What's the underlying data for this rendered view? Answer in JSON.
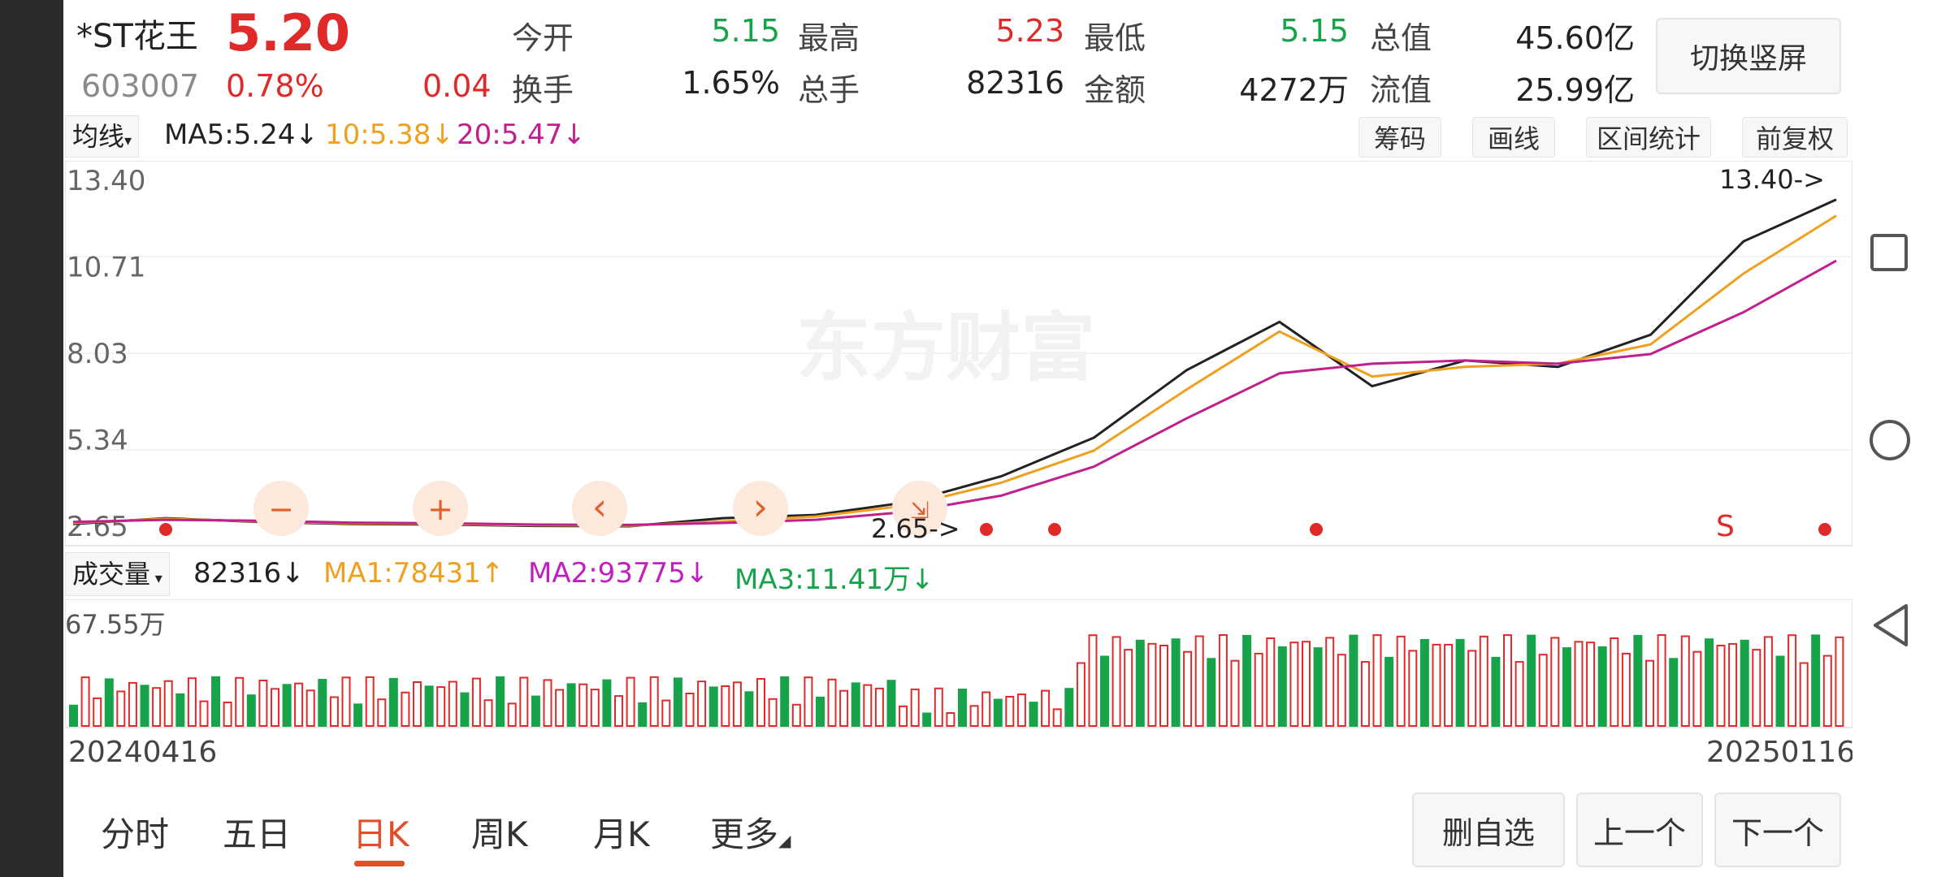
{
  "stock": {
    "name": "*ST花王",
    "price": "5.20",
    "code": "603007",
    "change_pct": "0.78%",
    "change_abs": "0.04"
  },
  "quote": {
    "open_label": "今开",
    "open": "5.15",
    "high_label": "最高",
    "high": "5.23",
    "low_label": "最低",
    "low": "5.15",
    "mcap_label": "总值",
    "mcap": "45.60亿",
    "turnover_label": "换手",
    "turnover": "1.65%",
    "volume_label": "总手",
    "volume": "82316",
    "amount_label": "金额",
    "amount": "4272万",
    "float_label": "流值",
    "float": "25.99亿"
  },
  "switch_button": "切换竖屏",
  "ma_bar": {
    "selector": "均线",
    "ma5": "MA5:5.24↓",
    "ma10": "10:5.38↓",
    "ma20": "20:5.47↓"
  },
  "tools": {
    "chips": "筹码",
    "draw": "画线",
    "range": "区间统计",
    "adjust": "前复权"
  },
  "watermark": "东方财富",
  "zoom_controls": {
    "zoom_out": "−",
    "zoom_in": "+",
    "left": "‹",
    "right": "›"
  },
  "annotations": {
    "high": "13.40->",
    "low": "2.65->",
    "signal": "S"
  },
  "volume_bar": {
    "selector": "成交量",
    "vol": "82316↓",
    "ma1": "MA1:78431↑",
    "ma2": "MA2:93775↓",
    "ma3": "MA3:11.41万↓"
  },
  "dates": {
    "start": "20240416",
    "end": "20250116"
  },
  "bottom": {
    "tabs": [
      "分时",
      "五日",
      "日K",
      "周K",
      "月K",
      "更多"
    ],
    "active_tab": "日K",
    "remove_watch": "删自选",
    "prev": "上一个",
    "next": "下一个"
  },
  "colors": {
    "up": "#e02a2a",
    "down": "#16a34a",
    "ma5": "#222222",
    "ma10": "#f0a020",
    "ma20": "#c0208c",
    "active_tab": "#e24d2a"
  },
  "chart_data": [
    {
      "type": "line",
      "title": "",
      "y_ticks": [
        "13.40",
        "10.71",
        "8.03",
        "5.34",
        "2.65"
      ],
      "ylim": [
        2.65,
        13.4
      ],
      "x": [
        "20240416",
        "20250116"
      ],
      "series": [
        {
          "name": "MA5",
          "values": [
            2.72,
            2.9,
            2.78,
            2.72,
            2.7,
            2.66,
            2.65,
            2.9,
            3.0,
            3.4,
            4.2,
            5.4,
            7.5,
            9.0,
            7.0,
            7.8,
            7.6,
            8.6,
            11.5,
            12.8
          ]
        },
        {
          "name": "MA10",
          "values": [
            2.75,
            2.88,
            2.8,
            2.74,
            2.72,
            2.68,
            2.67,
            2.8,
            2.95,
            3.3,
            4.0,
            5.0,
            6.9,
            8.7,
            7.3,
            7.6,
            7.7,
            8.3,
            10.5,
            12.3
          ]
        },
        {
          "name": "MA20",
          "values": [
            2.78,
            2.85,
            2.82,
            2.76,
            2.74,
            2.7,
            2.69,
            2.75,
            2.85,
            3.1,
            3.6,
            4.5,
            6.0,
            7.4,
            7.7,
            7.8,
            7.7,
            8.0,
            9.3,
            10.9
          ]
        }
      ]
    },
    {
      "type": "bar",
      "title": "",
      "y_ticks": [
        "67.55万"
      ],
      "ylim": [
        0,
        67.55
      ],
      "x": [
        "20240416",
        "20250116"
      ]
    }
  ]
}
